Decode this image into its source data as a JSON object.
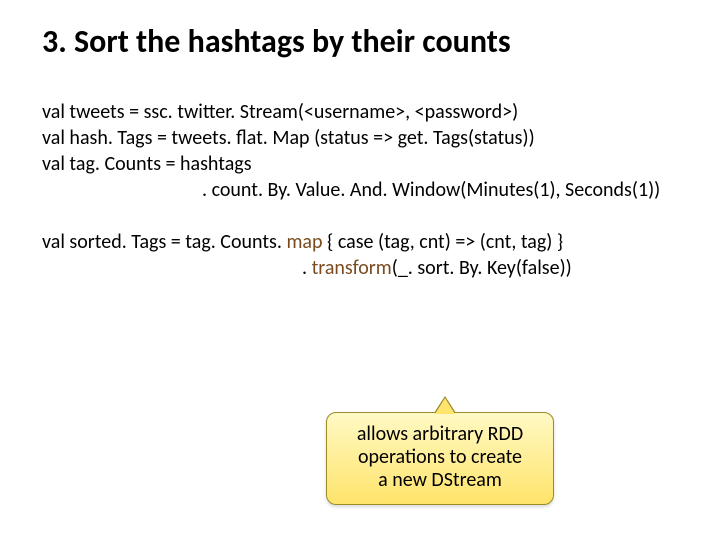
{
  "title": "3. Sort the hashtags by their counts",
  "code": {
    "l1": "val tweets = ssc. twitter. Stream(<username>, <password>)",
    "l2": "val hash. Tags = tweets. flat. Map (status => get. Tags(status))",
    "l3": "val tag. Counts = hashtags",
    "l4": ". count. By. Value. And. Window(Minutes(1), Seconds(1))",
    "l5_a": "val sorted. Tags = tag. Counts. ",
    "l5_map": "map ",
    "l5_b": "{ case (tag, cnt) => (cnt, tag) }",
    "l6_a": ". ",
    "l6_transform": "transform",
    "l6_b": "(_. sort. By. Key(false))"
  },
  "callout": {
    "line1": "allows arbitrary RDD",
    "line2": "operations to create",
    "line3": "a new DStream"
  }
}
